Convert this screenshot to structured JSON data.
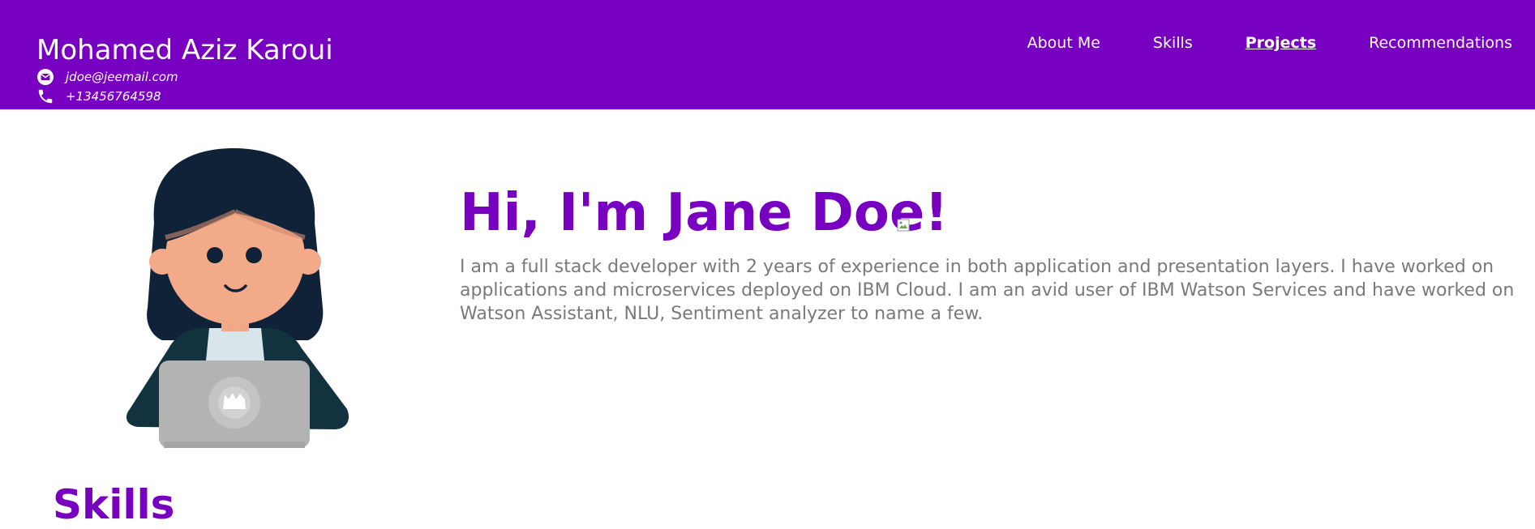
{
  "header": {
    "name": "Mohamed Aziz Karoui",
    "email": "jdoe@jeemail.com",
    "phone": "+13456764598",
    "nav": [
      {
        "label": "About Me",
        "active": false
      },
      {
        "label": "Skills",
        "active": false
      },
      {
        "label": "Projects",
        "active": true
      },
      {
        "label": "Recommendations",
        "active": false
      }
    ]
  },
  "hero": {
    "title": "Hi, I'm Jane Doe!",
    "bio": "I am a full stack developer with 2 years of experience in both application and presentation layers. I have worked on applications and microservices deployed on IBM Cloud. I am an avid user of IBM Watson Services and have worked on Watson Assistant, NLU, Sentiment analyzer to name a few."
  },
  "skills": {
    "title": "Skills"
  },
  "colors": {
    "accent": "#7800c0",
    "text_gray": "#7a7a7a"
  },
  "icons": {
    "email": "envelope-icon",
    "phone": "phone-icon"
  }
}
